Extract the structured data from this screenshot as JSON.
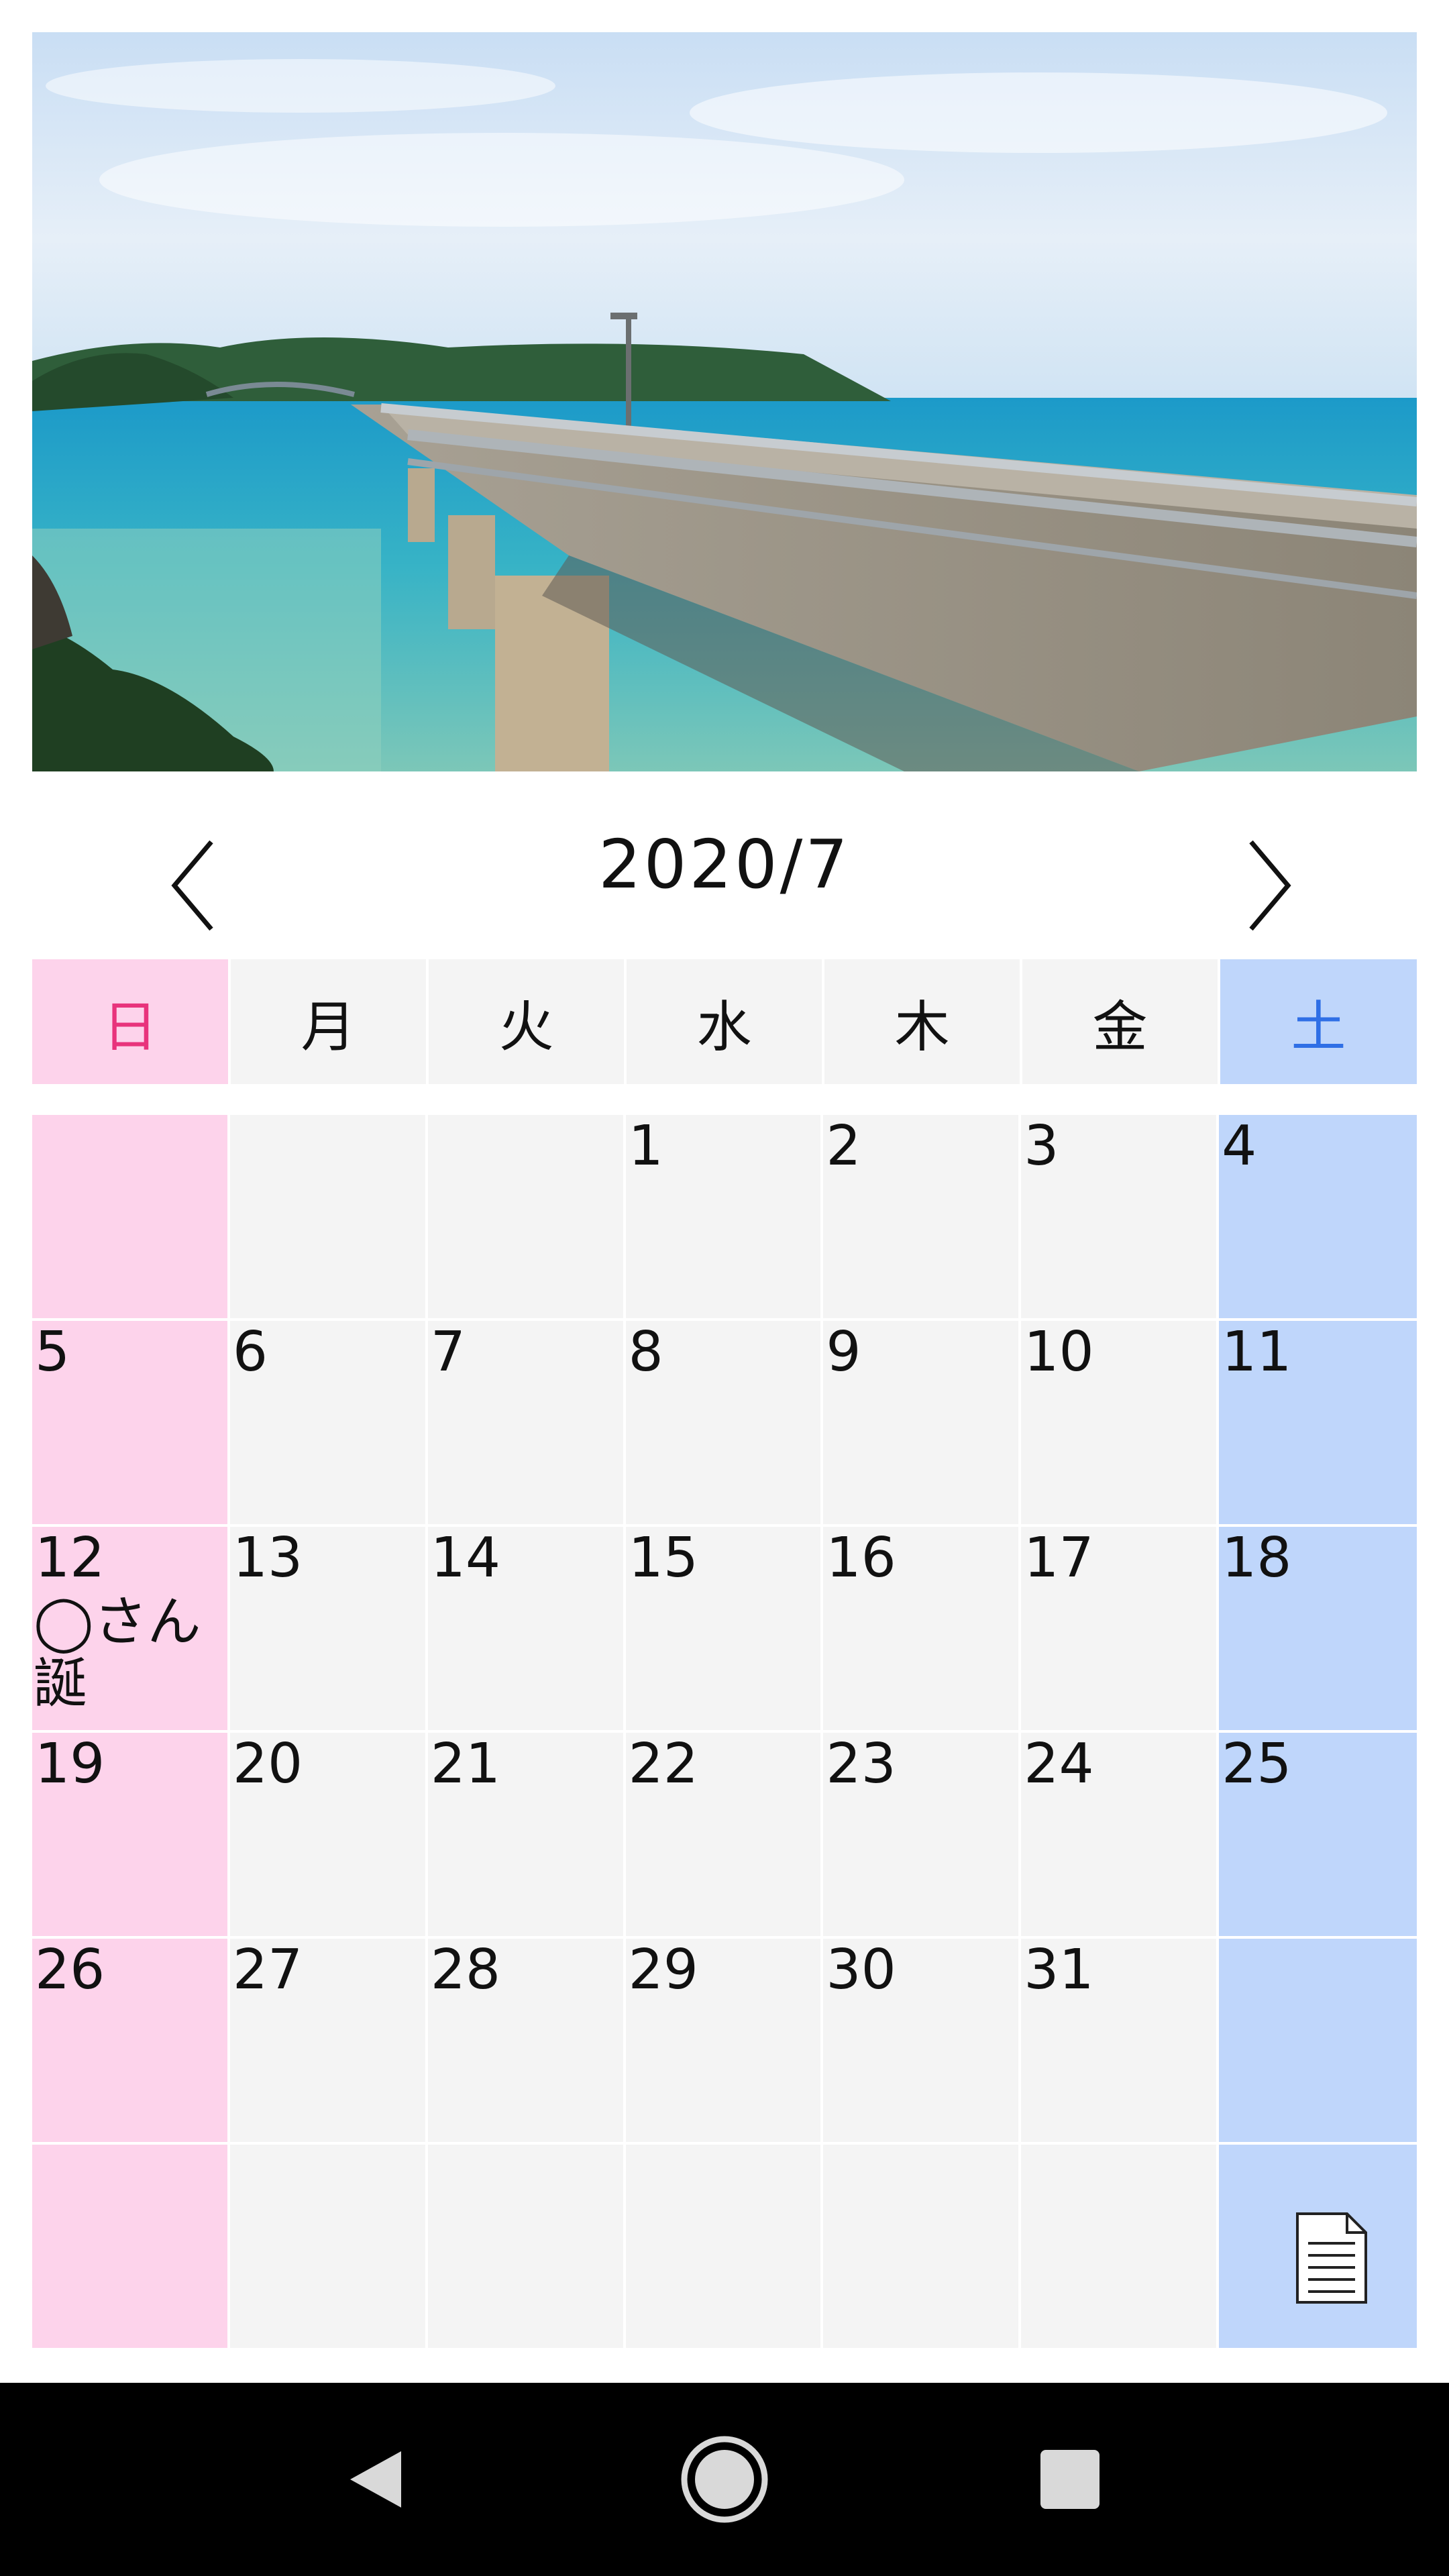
{
  "header_image": {
    "description_icon": "landscape-photo"
  },
  "calendar": {
    "month_title": "2020/7",
    "prev_icon": "chevron-left-icon",
    "next_icon": "chevron-right-icon",
    "weekdays": [
      "日",
      "月",
      "火",
      "水",
      "木",
      "金",
      "土"
    ],
    "weeks": [
      [
        "",
        "",
        "",
        "1",
        "2",
        "3",
        "4"
      ],
      [
        "5",
        "6",
        "7",
        "8",
        "9",
        "10",
        "11"
      ],
      [
        "12",
        "13",
        "14",
        "15",
        "16",
        "17",
        "18"
      ],
      [
        "19",
        "20",
        "21",
        "22",
        "23",
        "24",
        "25"
      ],
      [
        "26",
        "27",
        "28",
        "29",
        "30",
        "31",
        ""
      ],
      [
        "",
        "",
        "",
        "",
        "",
        "",
        ""
      ]
    ],
    "events": {
      "12": "◯さん誕"
    },
    "memo_icon": "document-icon"
  },
  "colors": {
    "sunday_bg": "#fdd3eb",
    "sunday_text": "#e8337c",
    "saturday_bg": "#bfd6fb",
    "saturday_text": "#2f6fe6",
    "weekday_bg": "#f4f4f4"
  },
  "system_nav": {
    "back_icon": "triangle-back-icon",
    "home_icon": "circle-home-icon",
    "recent_icon": "square-recents-icon"
  }
}
